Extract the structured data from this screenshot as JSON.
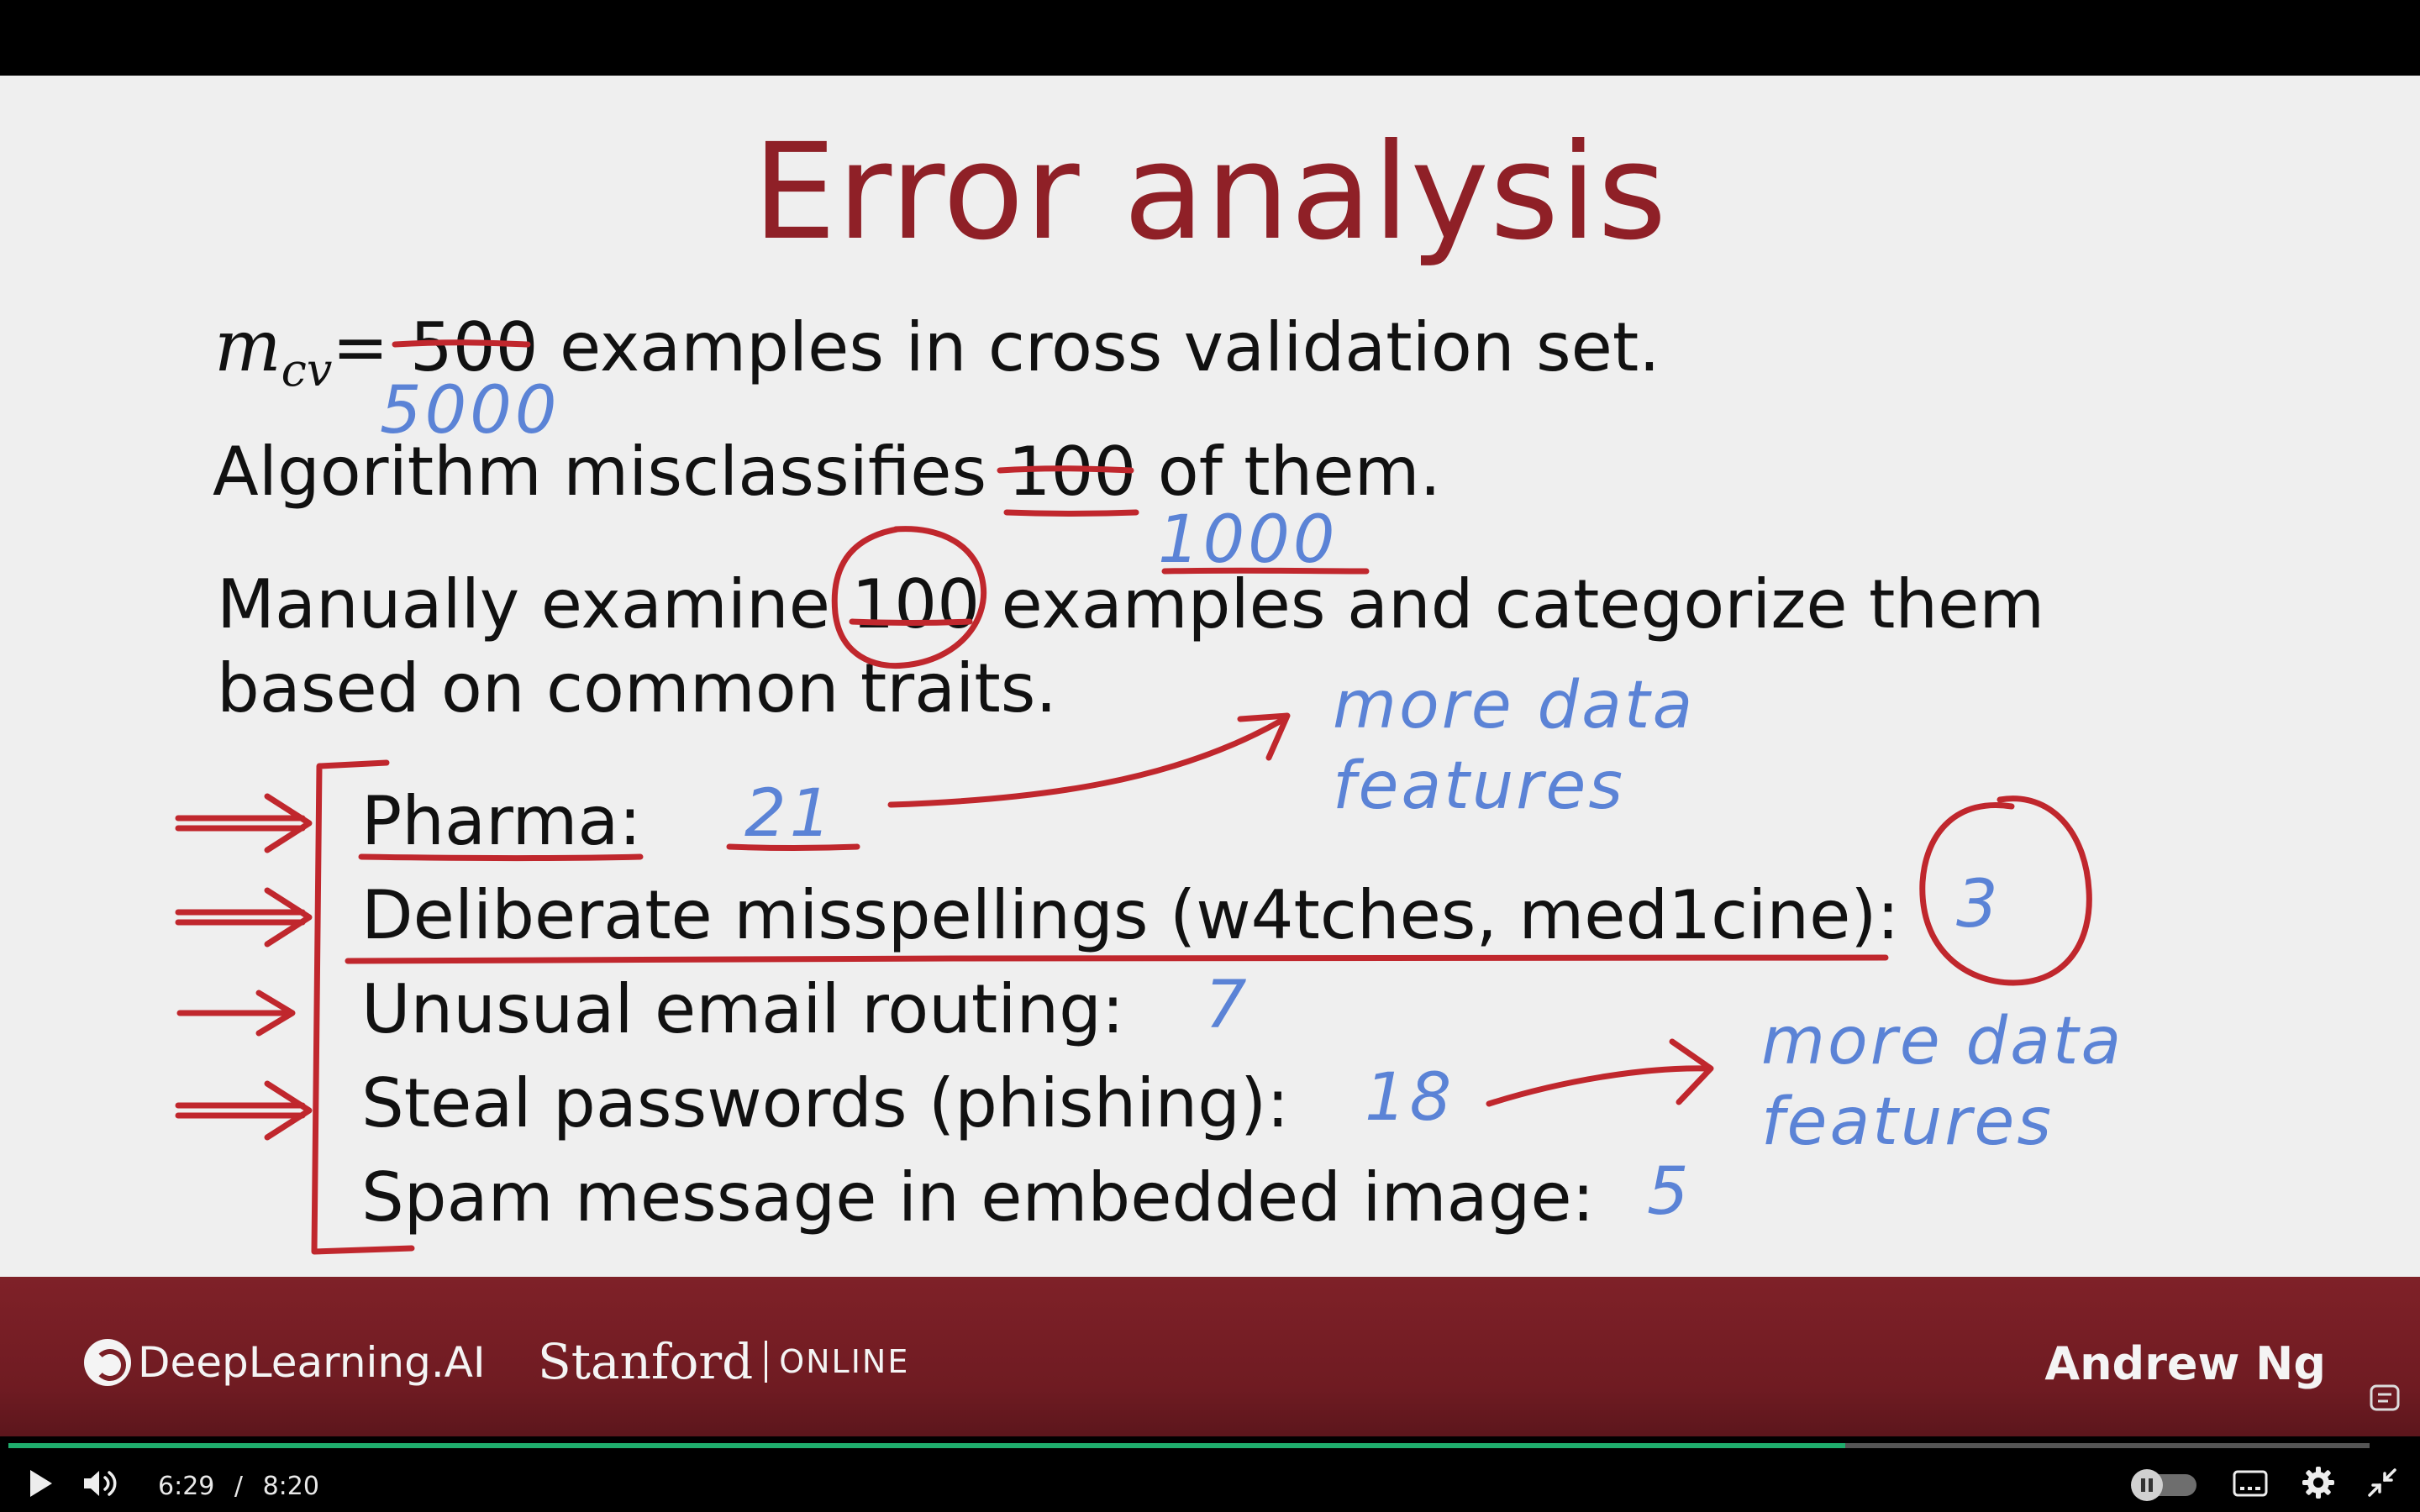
{
  "slide": {
    "title": "Error analysis",
    "line1": {
      "var": "m",
      "sub": "cv",
      "eq": "=",
      "struck": "500",
      "rest": "examples in cross validation set.",
      "hand": "5000"
    },
    "line2": {
      "prefix": "Algorithm misclassifies",
      "struck": "100",
      "suffix": "of them.",
      "hand": "1000"
    },
    "line3": {
      "prefix": "Manually examine",
      "circled": "100",
      "suffix": "examples and categorize them"
    },
    "line4": "based on common traits.",
    "categories": [
      {
        "label": "Pharma:",
        "count": "21"
      },
      {
        "label": "Deliberate misspellings (w4tches, med1cine):",
        "count": "3"
      },
      {
        "label": "Unusual email routing:",
        "count": "7"
      },
      {
        "label": "Steal passwords (phishing):",
        "count": "18"
      },
      {
        "label": "Spam message in embedded image:",
        "count": "5"
      }
    ],
    "notes": [
      "more data\nfeatures",
      "more data\nfeatures"
    ]
  },
  "banner": {
    "logo_deeplearning": "DeepLearning.AI",
    "logo_stanford": "Stanford",
    "logo_online": "ONLINE",
    "presenter": "Andrew Ng"
  },
  "player": {
    "current_time": "6:29",
    "separator": "/",
    "duration": "8:20",
    "progress_fraction": 0.778,
    "buffered_fraction": 0.776,
    "accent_color": "#1fae6d",
    "icons": [
      "play-icon",
      "volume-icon",
      "autoplay-toggle",
      "captions-icon",
      "settings-gear-icon",
      "exit-fullscreen-icon",
      "transcript-icon"
    ]
  }
}
